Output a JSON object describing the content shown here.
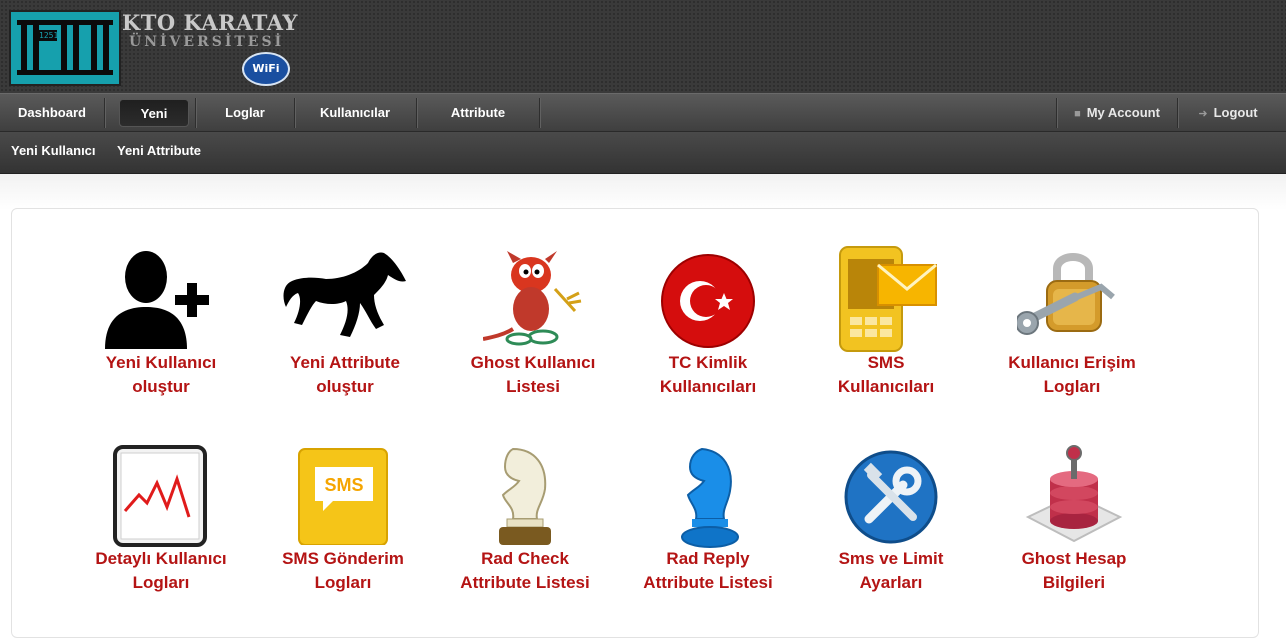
{
  "header": {
    "logo_title": "KTO KARATAY",
    "logo_subtitle": "ÜNİVERSİTESİ",
    "logo_wifi": "WiFi",
    "logo_tag": "1251"
  },
  "main_nav": {
    "items": [
      {
        "label": "Dashboard"
      },
      {
        "label": "Yeni",
        "active": true
      },
      {
        "label": "Loglar"
      },
      {
        "label": "Kullanıcılar"
      },
      {
        "label": "Attribute"
      }
    ],
    "my_account": "My Account",
    "logout": "Logout"
  },
  "sub_nav": {
    "items": [
      {
        "label": "Yeni Kullanıcı"
      },
      {
        "label": "Yeni Attribute"
      }
    ]
  },
  "tiles": [
    {
      "line1": "Yeni Kullanıcı",
      "line2": "oluştur",
      "icon": "add-user-icon"
    },
    {
      "line1": "Yeni Attribute",
      "line2": "oluştur",
      "icon": "horse-icon"
    },
    {
      "line1": "Ghost Kullanıcı",
      "line2": "Listesi",
      "icon": "daemon-mascot-icon"
    },
    {
      "line1": "TC Kimlik",
      "line2": "Kullanıcıları",
      "icon": "turkey-flag-icon"
    },
    {
      "line1": "SMS",
      "line2": "Kullanıcıları",
      "icon": "sms-phone-icon"
    },
    {
      "line1": "Kullanıcı Erişim",
      "line2": "Logları",
      "icon": "padlock-key-icon"
    },
    {
      "line1": "Detaylı Kullanıcı",
      "line2": "Logları",
      "icon": "line-chart-icon"
    },
    {
      "line1": "SMS Gönderim",
      "line2": "Logları",
      "icon": "sms-bubble-icon",
      "icon_text": "SMS"
    },
    {
      "line1": "Rad Check",
      "line2": "Attribute Listesi",
      "icon": "chess-knight-white-icon"
    },
    {
      "line1": "Rad Reply",
      "line2": "Attribute Listesi",
      "icon": "chess-knight-blue-icon"
    },
    {
      "line1": "Sms ve Limit",
      "line2": "Ayarları",
      "icon": "tools-icon"
    },
    {
      "line1": "Ghost Hesap",
      "line2": "Bilgileri",
      "icon": "database-lock-icon"
    }
  ],
  "colors": {
    "label_red": "#b41414",
    "header_bg": "#3a3a3a",
    "nav_bg": "#4a4a4a"
  }
}
